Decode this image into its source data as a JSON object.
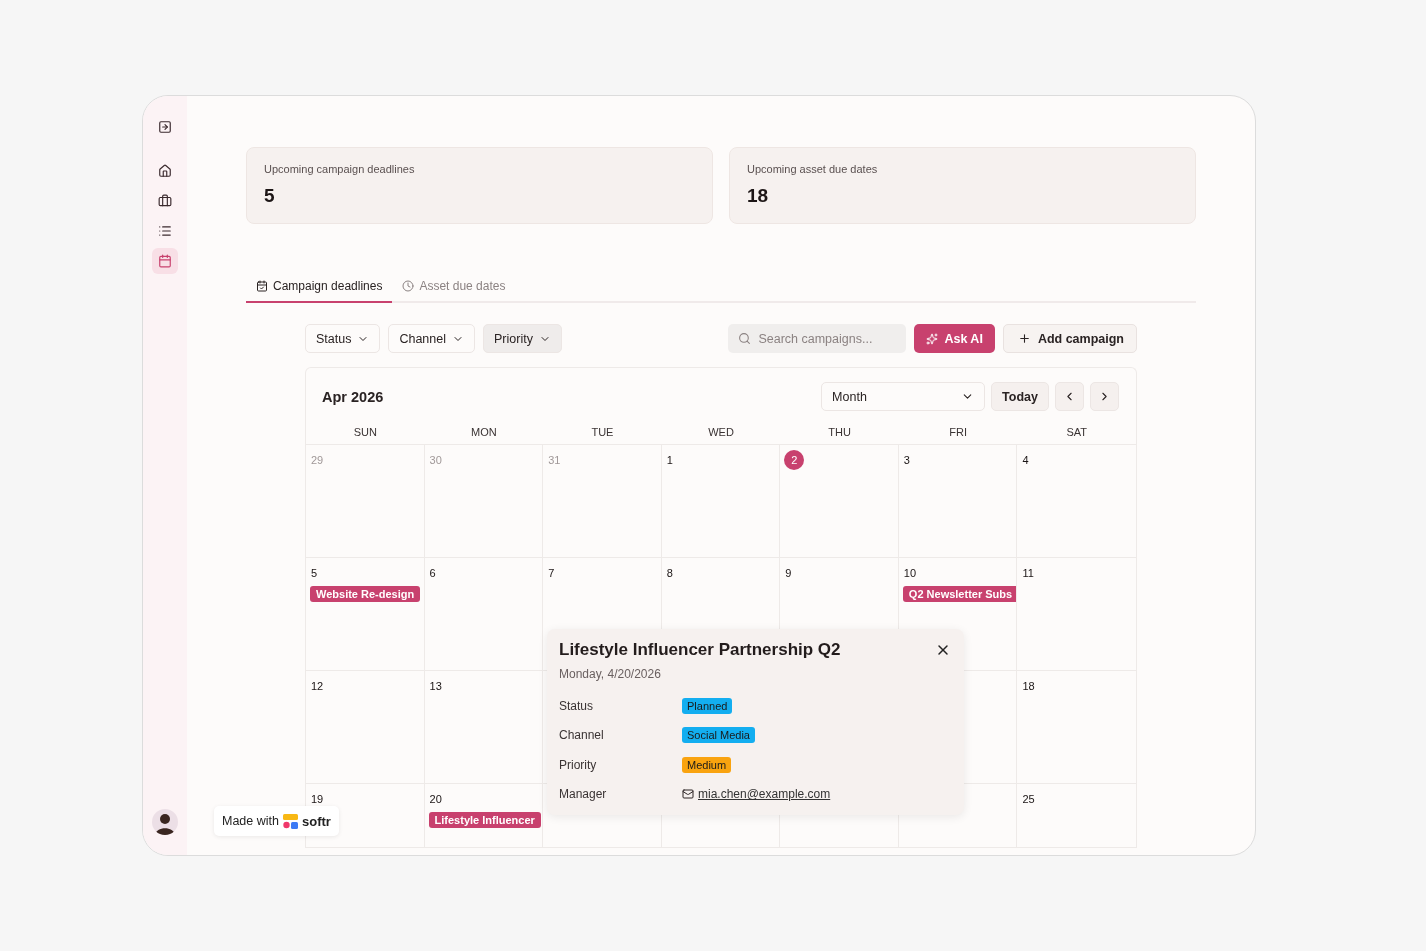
{
  "sidebar": {
    "items": [
      {
        "kind": "toggle",
        "selected": false
      },
      {
        "kind": "home",
        "selected": false
      },
      {
        "kind": "briefcase",
        "selected": false
      },
      {
        "kind": "list",
        "selected": false
      },
      {
        "kind": "calendar",
        "selected": true
      }
    ]
  },
  "stats": [
    {
      "label": "Upcoming campaign deadlines",
      "value": "5"
    },
    {
      "label": "Upcoming asset due dates",
      "value": "18"
    }
  ],
  "tabs": [
    {
      "label": "Campaign deadlines",
      "selected": true
    },
    {
      "label": "Asset due dates",
      "selected": false
    }
  ],
  "filters": [
    {
      "label": "Status",
      "active": false
    },
    {
      "label": "Channel",
      "active": false
    },
    {
      "label": "Priority",
      "active": true
    }
  ],
  "search": {
    "placeholder": "Search campaigns..."
  },
  "buttons": {
    "ask_ai": "Ask AI",
    "add_campaign": "Add campaign"
  },
  "calendar": {
    "title": "Apr 2026",
    "view": "Month",
    "today": "Today",
    "weekdays": [
      "SUN",
      "MON",
      "TUE",
      "WED",
      "THU",
      "FRI",
      "SAT"
    ],
    "weeks": [
      {
        "days": [
          {
            "day": "29",
            "outside": true,
            "today": false
          },
          {
            "day": "30",
            "outside": true,
            "today": false
          },
          {
            "day": "31",
            "outside": true,
            "today": false
          },
          {
            "day": "1",
            "outside": false,
            "today": false
          },
          {
            "day": "2",
            "outside": false,
            "today": true
          },
          {
            "day": "3",
            "outside": false,
            "today": false
          },
          {
            "day": "4",
            "outside": false,
            "today": false
          }
        ]
      },
      {
        "days": [
          {
            "day": "5",
            "outside": false,
            "today": false,
            "events": [
              "Website Re-design"
            ]
          },
          {
            "day": "6",
            "outside": false,
            "today": false
          },
          {
            "day": "7",
            "outside": false,
            "today": false
          },
          {
            "day": "8",
            "outside": false,
            "today": false
          },
          {
            "day": "9",
            "outside": false,
            "today": false
          },
          {
            "day": "10",
            "outside": false,
            "today": false,
            "events": [
              "Q2 Newsletter Subs"
            ]
          },
          {
            "day": "11",
            "outside": false,
            "today": false
          }
        ]
      },
      {
        "days": [
          {
            "day": "12",
            "outside": false,
            "today": false
          },
          {
            "day": "13",
            "outside": false,
            "today": false
          }
        ],
        "trailing_days": [
          {
            "day": "18",
            "outside": false,
            "today": false
          }
        ]
      },
      {
        "days": [
          {
            "day": "19",
            "outside": false,
            "today": false
          },
          {
            "day": "20",
            "outside": false,
            "today": false,
            "events": [
              "Lifestyle Influencer"
            ]
          }
        ],
        "trailing_days": [
          {
            "day": "25",
            "outside": false,
            "today": false
          }
        ]
      }
    ]
  },
  "popup": {
    "title": "Lifestyle Influencer Partnership Q2",
    "date": "Monday, 4/20/2026",
    "fields": [
      {
        "label": "Status",
        "kind": "tag",
        "value": "Planned",
        "color": "#13aef0"
      },
      {
        "label": "Channel",
        "kind": "tag",
        "value": "Social Media",
        "color": "#13aef0"
      },
      {
        "label": "Priority",
        "kind": "tag",
        "value": "Medium",
        "color": "#f9a30f"
      },
      {
        "label": "Manager",
        "kind": "email",
        "value": "mia.chen@example.com"
      }
    ]
  },
  "badge": {
    "text": "Made with",
    "brand": "softr"
  }
}
